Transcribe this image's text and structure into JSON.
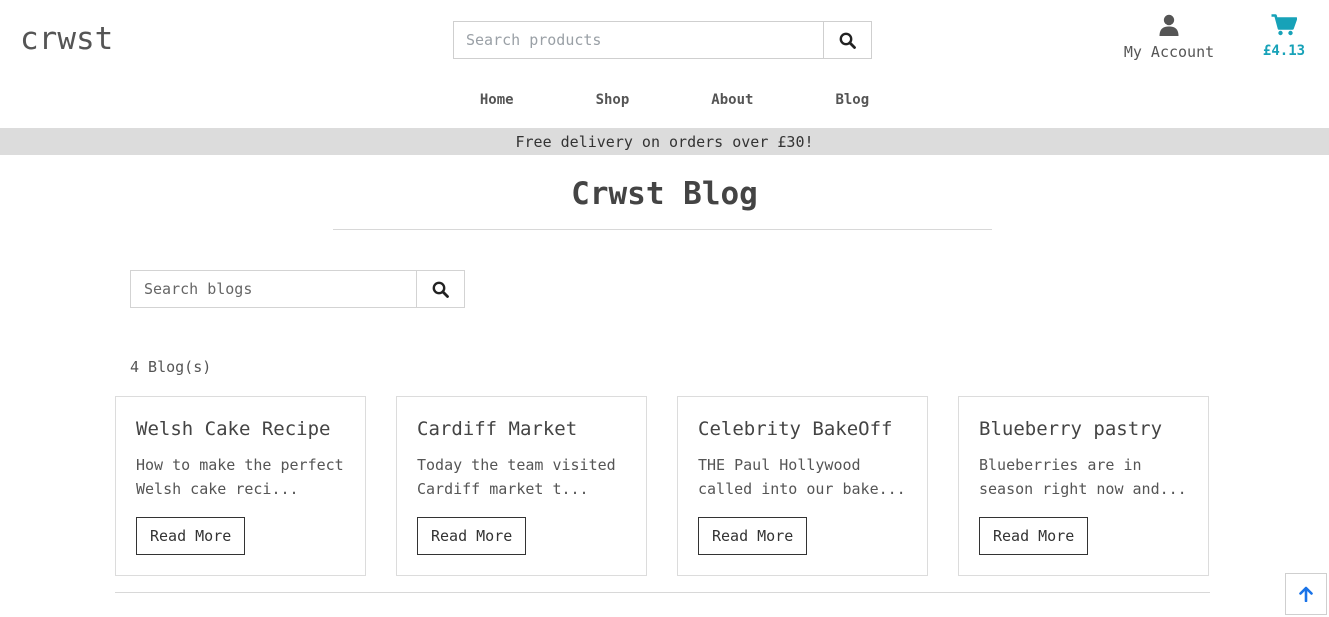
{
  "header": {
    "logo": "crwst",
    "search": {
      "placeholder": "Search products",
      "value": ""
    },
    "account_label": "My Account",
    "cart_total": "£4.13"
  },
  "nav": {
    "items": [
      "Home",
      "Shop",
      "About",
      "Blog"
    ]
  },
  "banner": "Free delivery on orders over £30!",
  "page": {
    "title": "Crwst Blog",
    "blog_search": {
      "placeholder": "Search blogs",
      "value": ""
    },
    "count_text": "4 Blog(s)"
  },
  "blogs": [
    {
      "title": "Welsh Cake Recipe",
      "excerpt": "How to make the perfect Welsh cake reci...",
      "button": "Read More"
    },
    {
      "title": "Cardiff Market",
      "excerpt": "Today the team visited Cardiff market t...",
      "button": "Read More"
    },
    {
      "title": "Celebrity BakeOff",
      "excerpt": "THE Paul Hollywood called into our bake...",
      "button": "Read More"
    },
    {
      "title": "Blueberry pastry",
      "excerpt": "Blueberries are in season right now and...",
      "button": "Read More"
    }
  ],
  "icons": {
    "search": "search-icon",
    "account": "user-icon",
    "cart": "cart-icon",
    "back_to_top": "arrow-up-icon"
  },
  "colors": {
    "accent": "#17a2b8",
    "back_to_top_arrow": "#1a73e8",
    "banner_bg": "#dcdcdc"
  }
}
